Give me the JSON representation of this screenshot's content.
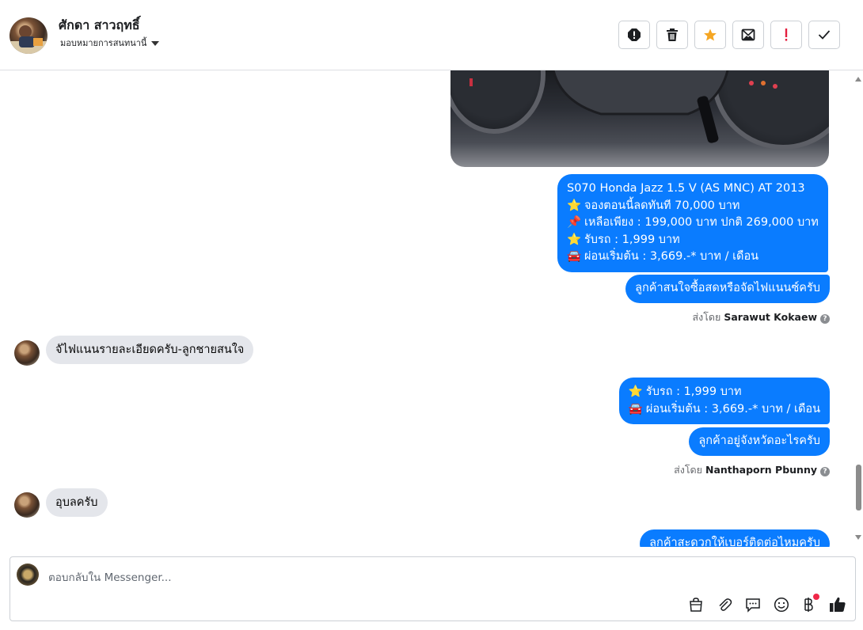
{
  "header": {
    "name": "ศักดา สาวฤทธิ์",
    "assign_label": "มอบหมายการสนทนานี้",
    "tools": [
      "report-icon",
      "trash-icon",
      "star-icon",
      "mark-unread-icon",
      "important-icon",
      "check-icon"
    ]
  },
  "colors": {
    "bubble_out": "#0a7cff",
    "bubble_in": "#e4e6eb",
    "star": "#f5a623",
    "important": "#e41e3f"
  },
  "messages": {
    "m1": {
      "line1": "S070 Honda Jazz 1.5 V (AS MNC) AT 2013",
      "line2_emoji": "⭐",
      "line2": "จองตอนนี้ลดทันที 70,000 บาท",
      "line3_emoji": "📌",
      "line3": "เหลือเพียง : 199,000 บาท ปกติ 269,000 บาท",
      "line4_emoji": "⭐",
      "line4": "รับรถ : 1,999 บาท",
      "line5_emoji": "🚘",
      "line5": "ผ่อนเริ่มต้น : 3,669.-* บาท / เดือน"
    },
    "m2": "ลูกค้าสนใจซื้อสดหรือจัดไฟแนนซ์ครับ",
    "sent_by_1_prefix": "ส่งโดย",
    "sent_by_1_name": "Sarawut Kokaew",
    "in1": "จัไฟแนนรายละเอียดครับ-ลูกชายสนใจ",
    "m3": {
      "line1_emoji": "⭐",
      "line1": "รับรถ : 1,999 บาท",
      "line2_emoji": "🚘",
      "line2": "ผ่อนเริ่มต้น : 3,669.-* บาท / เดือน"
    },
    "m4": "ลูกค้าอยู่จังหวัดอะไรครับ",
    "sent_by_2_prefix": "ส่งโดย",
    "sent_by_2_name": "Nanthaporn Pbunny",
    "in2": "อุบลครับ",
    "m5": "ลูกค้าสะดวกให้เบอร์ติดต่อไหมครับ"
  },
  "composer": {
    "placeholder": "ตอบกลับใน Messenger...",
    "icons": [
      "shop-bag-icon",
      "attachment-icon",
      "saved-reply-icon",
      "emoji-icon",
      "baht-icon",
      "like-icon"
    ]
  }
}
